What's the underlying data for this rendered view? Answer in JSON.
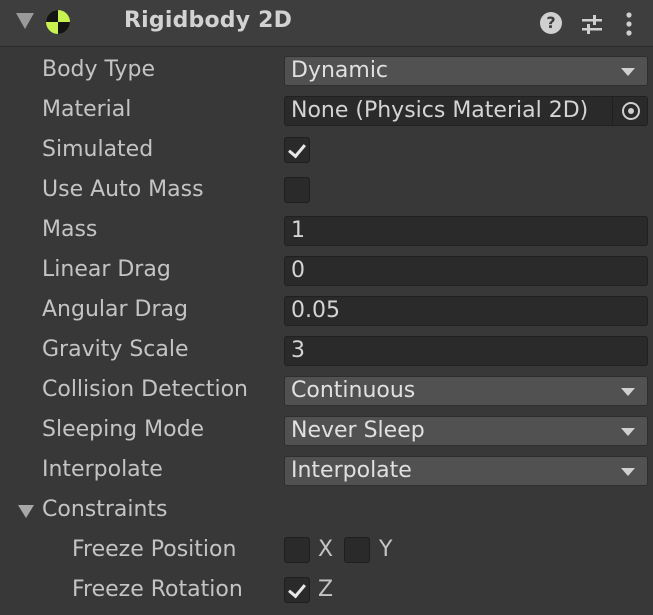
{
  "component": {
    "title": "Rigidbody 2D",
    "accent_color": "#c7f24f",
    "icons": [
      "help-icon",
      "presets-icon",
      "more-menu-icon"
    ]
  },
  "properties": {
    "body_type": {
      "label": "Body Type",
      "value": "Dynamic"
    },
    "material": {
      "label": "Material",
      "value": "None (Physics Material 2D)"
    },
    "simulated": {
      "label": "Simulated",
      "checked": true
    },
    "use_auto_mass": {
      "label": "Use Auto Mass",
      "checked": false
    },
    "mass": {
      "label": "Mass",
      "value": "1"
    },
    "linear_drag": {
      "label": "Linear Drag",
      "value": "0"
    },
    "angular_drag": {
      "label": "Angular Drag",
      "value": "0.05"
    },
    "gravity_scale": {
      "label": "Gravity Scale",
      "value": "3"
    },
    "collision_detection": {
      "label": "Collision Detection",
      "value": "Continuous"
    },
    "sleeping_mode": {
      "label": "Sleeping Mode",
      "value": "Never Sleep"
    },
    "interpolate": {
      "label": "Interpolate",
      "value": "Interpolate"
    }
  },
  "constraints": {
    "label": "Constraints",
    "freeze_position": {
      "label": "Freeze Position",
      "x_label": "X",
      "y_label": "Y",
      "x": false,
      "y": false
    },
    "freeze_rotation": {
      "label": "Freeze Rotation",
      "z_label": "Z",
      "z": true
    }
  }
}
